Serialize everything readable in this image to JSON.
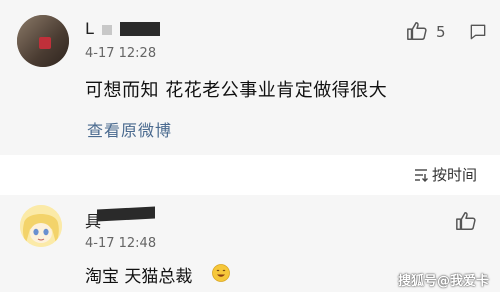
{
  "comment1": {
    "username": "L",
    "time": "4-17 12:28",
    "like_count": "5",
    "text": "可想而知 花花老公事业肯定做得很大",
    "view_original": "查看原微博"
  },
  "sort": {
    "label": "按时间"
  },
  "comment2": {
    "username": "具",
    "time": "4-17 12:48",
    "text": "淘宝 天猫总裁"
  },
  "watermark": "搜狐号@我爱卡",
  "icons": {
    "like": "thumbs-up-icon",
    "reply": "speech-bubble-icon",
    "sort": "sort-icon",
    "emoji": "smile-emoji-icon"
  },
  "colors": {
    "link": "#4a6a8f",
    "background": "#f6f6f6"
  }
}
